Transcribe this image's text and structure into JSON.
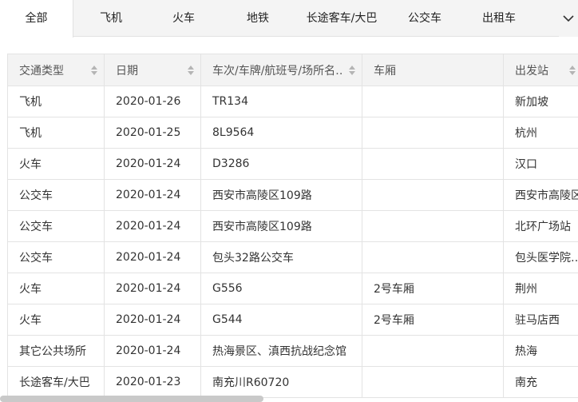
{
  "tabs": [
    {
      "label": "全部",
      "active": true
    },
    {
      "label": "飞机"
    },
    {
      "label": "火车"
    },
    {
      "label": "地铁"
    },
    {
      "label": "长途客车/大巴"
    },
    {
      "label": "公交车"
    },
    {
      "label": "出租车"
    }
  ],
  "table": {
    "headers": [
      "交通类型",
      "日期",
      "车次/车牌/航班号/场所名…",
      "车厢",
      "出发站"
    ],
    "sortable": [
      true,
      true,
      true,
      false,
      true
    ],
    "rows": [
      [
        "飞机",
        "2020-01-26",
        "TR134",
        "",
        "新加坡"
      ],
      [
        "飞机",
        "2020-01-25",
        "8L9564",
        "",
        "杭州"
      ],
      [
        "火车",
        "2020-01-24",
        "D3286",
        "",
        "汉口"
      ],
      [
        "公交车",
        "2020-01-24",
        "西安市高陵区109路",
        "",
        "西安市高陵区"
      ],
      [
        "公交车",
        "2020-01-24",
        "西安市高陵区109路",
        "",
        "北环广场站"
      ],
      [
        "公交车",
        "2020-01-24",
        "包头32路公交车",
        "",
        "包头医学院…"
      ],
      [
        "火车",
        "2020-01-24",
        "G556",
        "2号车厢",
        "荆州"
      ],
      [
        "火车",
        "2020-01-24",
        "G544",
        "2号车厢",
        "驻马店西"
      ],
      [
        "其它公共场所",
        "2020-01-24",
        "热海景区、滇西抗战纪念馆",
        "",
        "热海"
      ],
      [
        "长途客车/大巴",
        "2020-01-23",
        "南充川R60720",
        "",
        "南充"
      ]
    ]
  },
  "icons": {
    "sort": "sort-arrows-icon",
    "more": "chevron-down-icon"
  }
}
